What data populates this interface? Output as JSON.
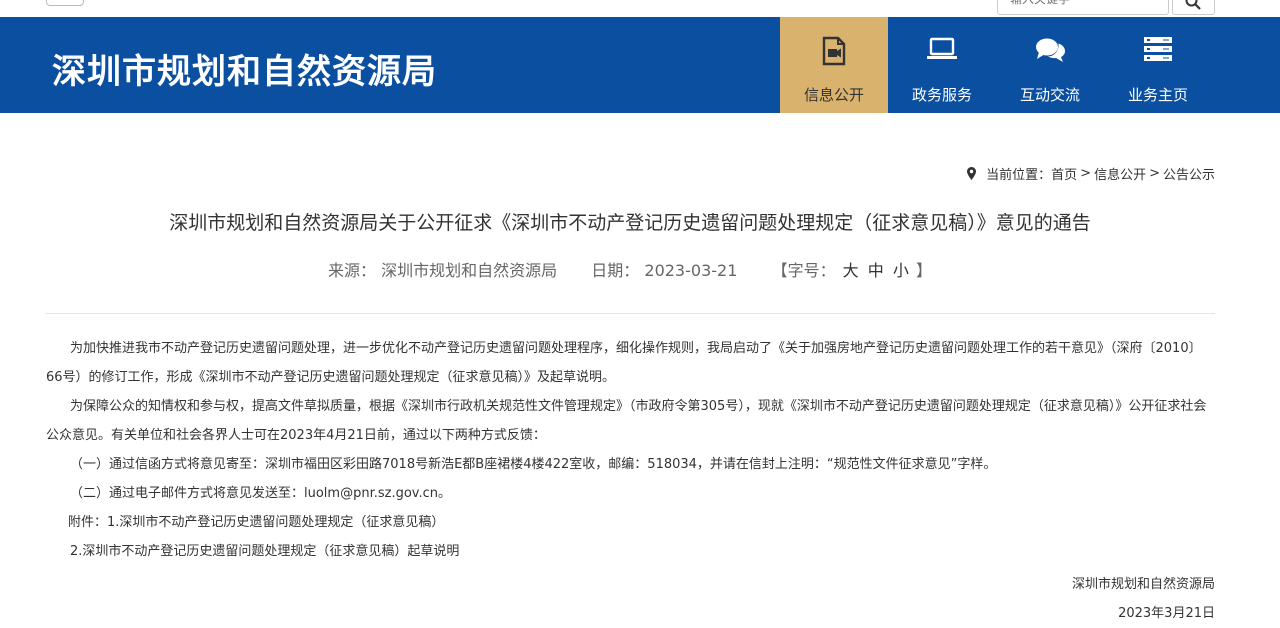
{
  "topbar": {
    "search_placeholder": "输入关键字"
  },
  "header": {
    "site_title": "深圳市规划和自然资源局",
    "nav": [
      {
        "label": "信息公开",
        "icon": "document-icon",
        "active": true
      },
      {
        "label": "政务服务",
        "icon": "laptop-icon",
        "active": false
      },
      {
        "label": "互动交流",
        "icon": "chat-bubbles-icon",
        "active": false
      },
      {
        "label": "业务主页",
        "icon": "server-icon",
        "active": false
      }
    ]
  },
  "breadcrumb": {
    "prefix": "当前位置：",
    "items": [
      "首页",
      "信息公开",
      "公告公示"
    ],
    "separator": ">"
  },
  "article": {
    "title": "深圳市规划和自然资源局关于公开征求《深圳市不动产登记历史遗留问题处理规定（征求意见稿）》意见的通告",
    "source_label": "来源：",
    "source": "深圳市规划和自然资源局",
    "date_label": "日期：",
    "date": "2023-03-21",
    "font_size_label": "【字号：",
    "font_sizes": [
      "大",
      "中",
      "小"
    ],
    "font_size_close": "】",
    "paragraphs": [
      "为加快推进我市不动产登记历史遗留问题处理，进一步优化不动产登记历史遗留问题处理程序，细化操作规则，我局启动了《关于加强房地产登记历史遗留问题处理工作的若干意见》（深府〔2010〕66号）的修订工作，形成《深圳市不动产登记历史遗留问题处理规定（征求意见稿）》及起草说明。",
      "为保障公众的知情权和参与权，提高文件草拟质量，根据《深圳市行政机关规范性文件管理规定》（市政府令第305号），现就《深圳市不动产登记历史遗留问题处理规定（征求意见稿）》公开征求社会公众意见。有关单位和社会各界人士可在2023年4月21日前，通过以下两种方式反馈："
    ],
    "feedback_methods": [
      "（一）通过信函方式将意见寄至：深圳市福田区彩田路7018号新浩E都B座裙楼4楼422室收，邮编：518034，并请在信封上注明：“规范性文件征求意见”字样。",
      "（二）通过电子邮件方式将意见发送至：luolm@pnr.sz.gov.cn。"
    ],
    "attachments": [
      "附件：1.深圳市不动产登记历史遗留问题处理规定（征求意见稿）",
      "2.深圳市不动产登记历史遗留问题处理规定（征求意见稿）起草说明"
    ],
    "signature": "深圳市规划和自然资源局",
    "signature_date": "2023年3月21日"
  },
  "colors": {
    "header_bg": "#0a4fa0",
    "nav_active_bg": "#d9b26e"
  }
}
